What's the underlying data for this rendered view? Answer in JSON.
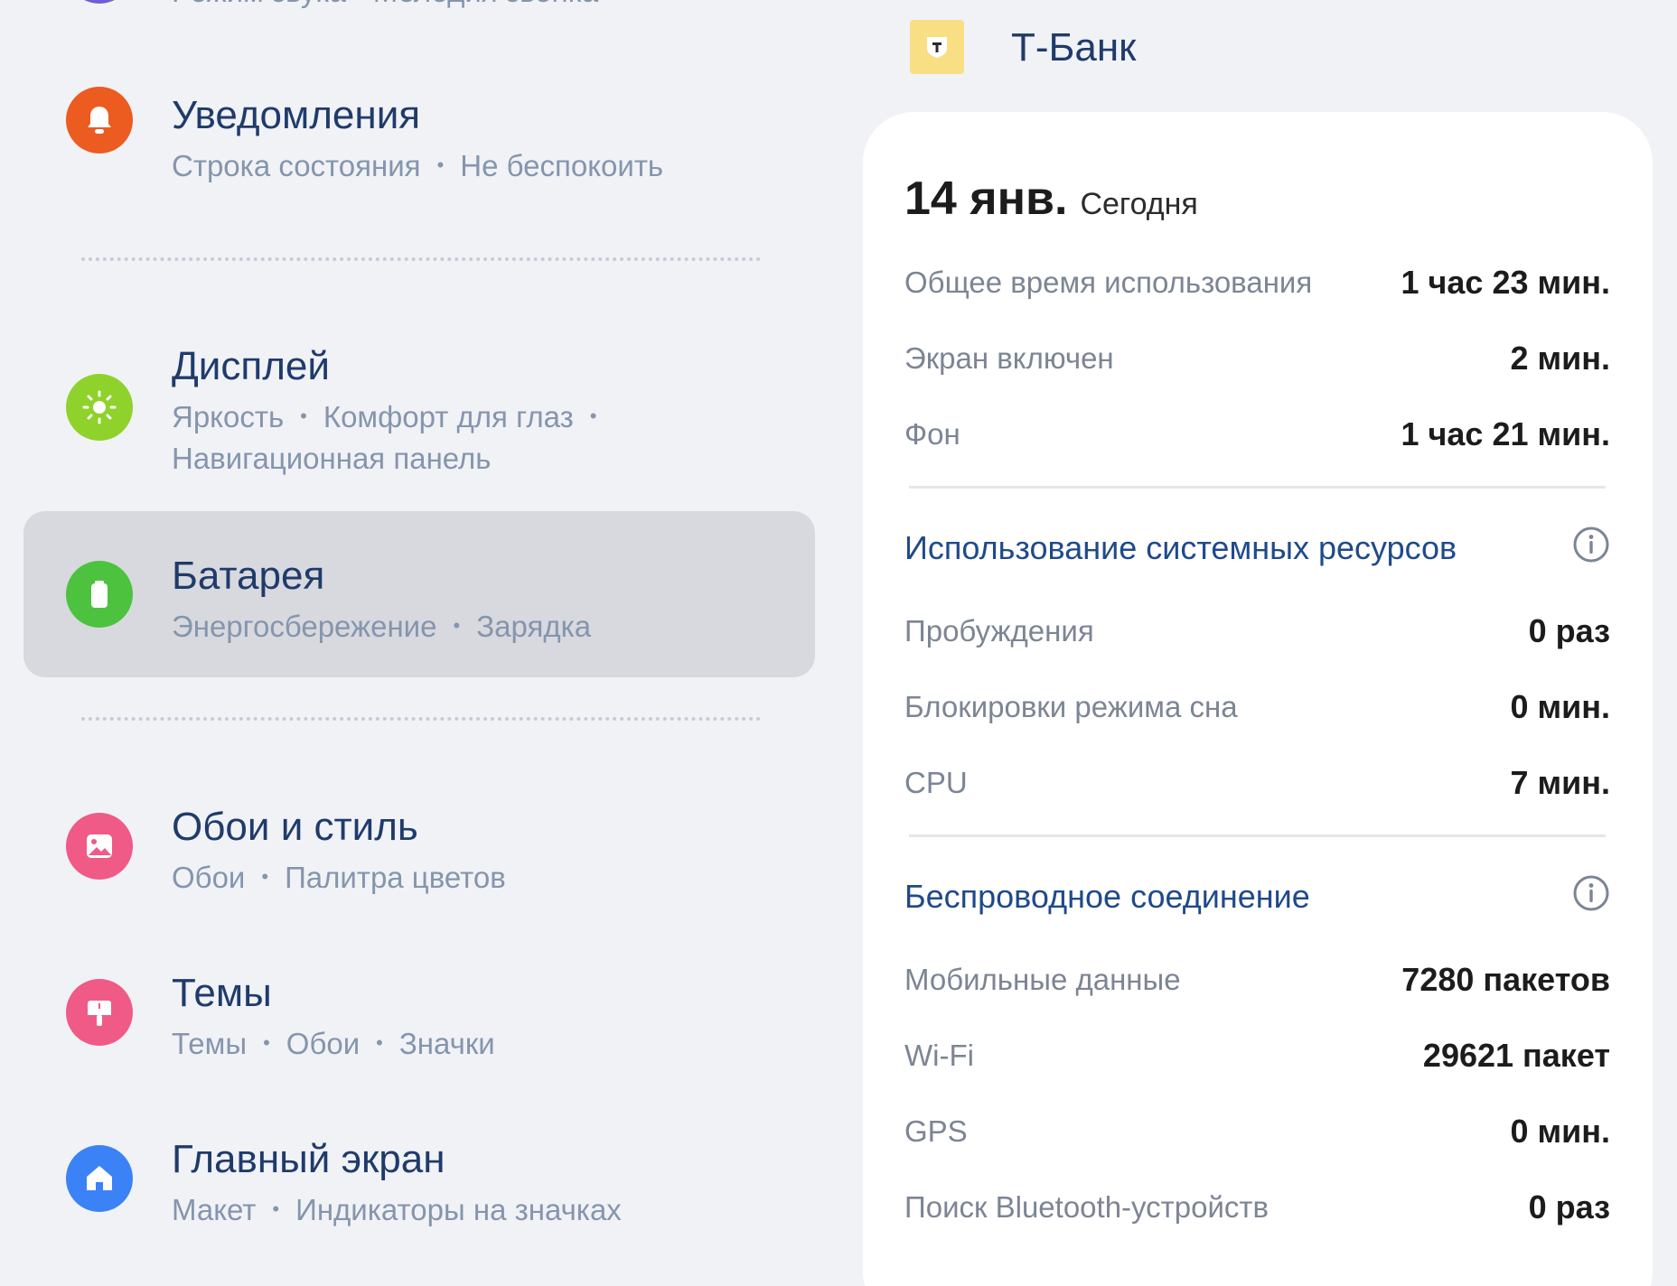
{
  "settings": {
    "top_fragment": "Режим звука  •  Мелодия звонка",
    "items": [
      {
        "title": "Уведомления",
        "subtitle_parts": [
          "Строка состояния",
          "Не беспокоить"
        ],
        "icon": "bell-icon",
        "color": "#ec5b1f"
      },
      {
        "title": "Дисплей",
        "subtitle_parts": [
          "Яркость",
          "Комфорт для глаз",
          "Навигационная панель"
        ],
        "icon": "sun-icon",
        "color": "#8fd22b"
      },
      {
        "title": "Батарея",
        "subtitle_parts": [
          "Энергосбережение",
          "Зарядка"
        ],
        "icon": "battery-icon",
        "color": "#4cc23f",
        "selected": true
      },
      {
        "title": "Обои и стиль",
        "subtitle_parts": [
          "Обои",
          "Палитра цветов"
        ],
        "icon": "image-icon",
        "color": "#ef5a87"
      },
      {
        "title": "Темы",
        "subtitle_parts": [
          "Темы",
          "Обои",
          "Значки"
        ],
        "icon": "brush-icon",
        "color": "#ef5a87"
      },
      {
        "title": "Главный экран",
        "subtitle_parts": [
          "Макет",
          "Индикаторы на значках"
        ],
        "icon": "home-icon",
        "color": "#3a82f6"
      }
    ]
  },
  "app": {
    "name": "Т-Банк",
    "icon": "t-bank-logo-icon",
    "icon_color": "#f9df84",
    "date": "14 янв.",
    "date_suffix": "Сегодня",
    "usage": [
      {
        "label": "Общее время использования",
        "value": "1 час 23 мин."
      },
      {
        "label": "Экран включен",
        "value": "2 мин."
      },
      {
        "label": "Фон",
        "value": "1 час 21 мин."
      }
    ],
    "system_resources": {
      "title": "Использование системных ресурсов",
      "rows": [
        {
          "label": "Пробуждения",
          "value": "0 раз"
        },
        {
          "label": "Блокировки режима сна",
          "value": "0 мин."
        },
        {
          "label": "CPU",
          "value": "7 мин."
        }
      ]
    },
    "wireless": {
      "title": "Беспроводное соединение",
      "rows": [
        {
          "label": "Мобильные данные",
          "value": "7280 пакетов"
        },
        {
          "label": "Wi-Fi",
          "value": "29621 пакет"
        },
        {
          "label": "GPS",
          "value": "0 мин."
        },
        {
          "label": "Поиск Bluetooth-устройств",
          "value": "0 раз"
        }
      ]
    }
  }
}
